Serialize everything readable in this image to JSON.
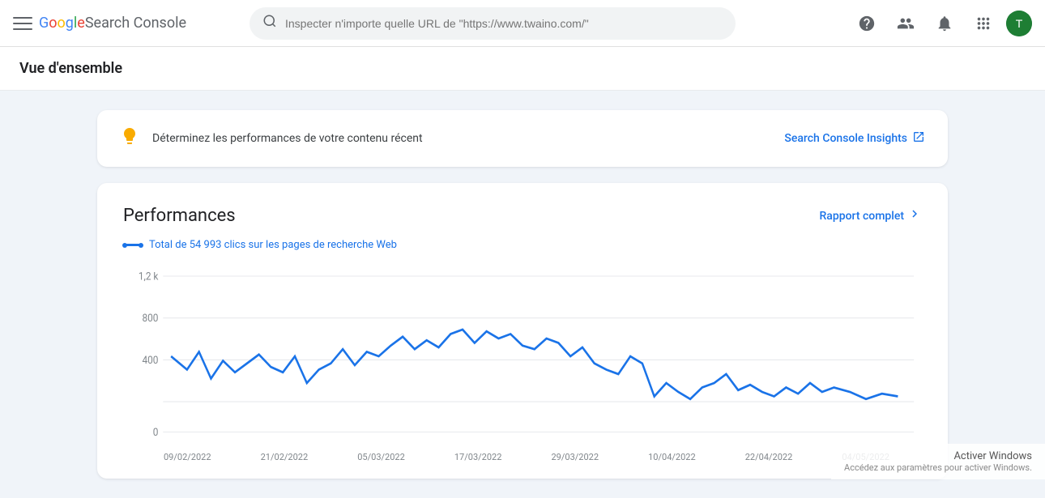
{
  "app": {
    "title": "Google Search Console",
    "logo": {
      "google": "Google",
      "rest": " Search Console"
    }
  },
  "topnav": {
    "search_placeholder": "Inspecter n'importe quelle URL de \"https://www.twaino.com/\"",
    "help_icon": "?",
    "person_icon": "👤",
    "bell_icon": "🔔",
    "grid_icon": "⊞"
  },
  "page": {
    "title": "Vue d'ensemble"
  },
  "insights_banner": {
    "text": "Déterminez les performances de votre contenu récent",
    "link_label": "Search Console Insights",
    "bulb": "💡"
  },
  "performance": {
    "title": "Performances",
    "rapport_label": "Rapport complet",
    "legend_text": "Total de 54 993 clics sur les pages de recherche Web",
    "y_labels": [
      "1,2 k",
      "800",
      "400",
      "0"
    ],
    "x_labels": [
      "09/02/2022",
      "21/02/2022",
      "05/03/2022",
      "17/03/2022",
      "29/03/2022",
      "10/04/2022",
      "22/04/2022",
      "04/05/2022"
    ]
  },
  "activate_windows": {
    "title": "Activer Windows",
    "subtitle": "Accédez aux paramètres pour activer Windows."
  }
}
